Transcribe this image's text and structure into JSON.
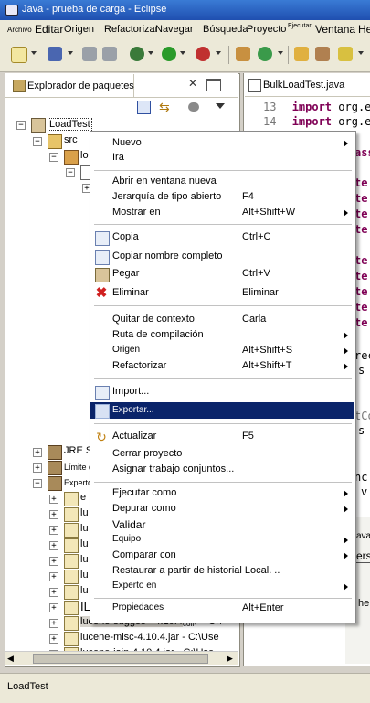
{
  "window": {
    "title": "Java - prueba de carga - Eclipse"
  },
  "menubar": [
    "Archivo",
    "Editar",
    "Origen",
    "Refactorizar",
    "Navegar",
    "Búsqueda",
    "Proyecto",
    "Ejecutar",
    "Ventana",
    "He"
  ],
  "left_view": {
    "tab_title": "Explorador de paquetes",
    "tree": [
      {
        "label": "LoadTest",
        "expander": "−"
      },
      {
        "label": "src",
        "expander": "−"
      },
      {
        "label": "lo",
        "expander": "−"
      },
      {
        "label": "",
        "expander": "−"
      },
      {
        "label": "",
        "expander": "+"
      },
      {
        "label": "JRE S",
        "expander": "+"
      },
      {
        "label": "Límite de",
        "expander": "+"
      },
      {
        "label": "Experto en",
        "expander": "−"
      },
      {
        "label": "e",
        "expander": "+"
      },
      {
        "label": "lu",
        "expander": "+"
      },
      {
        "label": "lu",
        "expander": "+"
      },
      {
        "label": "lu",
        "expander": "+"
      },
      {
        "label": "lu",
        "expander": "+"
      },
      {
        "label": "lu",
        "expander": "+"
      },
      {
        "label": "lu",
        "expander": "+"
      },
      {
        "label": "IL",
        "expander": "+"
      },
      {
        "label": "lucene-sugges - 4.10.4",
        "expander": "+",
        "suffix": "C:\\",
        "note": "coif-"
      },
      {
        "label": "lucene-misc-4.10.4.jar - C:\\Use",
        "expander": "+"
      },
      {
        "label": "lucene-join-4.10.4.jar - C:\\Use",
        "expander": "+"
      }
    ]
  },
  "editor": {
    "tab_title": "BulkLoadTest.java",
    "lines": [
      {
        "num": "13",
        "kw": "import",
        "text": " org.e"
      },
      {
        "num": "14",
        "kw": "import",
        "text": " org.e"
      }
    ],
    "fragments": [
      "ass",
      "te",
      "te",
      "te",
      "te",
      "te",
      "te",
      "te",
      "te",
      "te",
      "rec",
      "s",
      "tCo",
      "s",
      "nc",
      "v",
      "ava",
      "ers",
      "he"
    ]
  },
  "statusbar": {
    "text": "LoadTest"
  },
  "context_menu": {
    "items": [
      {
        "label": "Nuevo",
        "accel": "",
        "submenu": true
      },
      {
        "label": "Ira",
        "accel": "",
        "submenu": false
      },
      {
        "sep": true
      },
      {
        "label": "Abrir en ventana nueva",
        "accel": "",
        "submenu": false
      },
      {
        "label": "Jerarquía de tipo abierto",
        "accel": "F4",
        "submenu": false
      },
      {
        "label": "Mostrar en",
        "accel": "Alt+Shift+W",
        "submenu": true
      },
      {
        "sep": true
      },
      {
        "label": "Copia",
        "accel": "Ctrl+C",
        "submenu": false,
        "icon": "copy-icon"
      },
      {
        "label": "Copiar nombre completo",
        "accel": "",
        "submenu": false,
        "icon": "copy-qualified-name-icon"
      },
      {
        "label": "Pegar",
        "accel": "Ctrl+V",
        "submenu": false,
        "icon": "paste-icon"
      },
      {
        "label": "Eliminar",
        "accel": "Eliminar",
        "submenu": false,
        "icon": "delete-icon"
      },
      {
        "sep": true
      },
      {
        "label": "Quitar de contexto",
        "accel": "Carla",
        "submenu": false
      },
      {
        "label": "Ruta de compilación",
        "accel": "",
        "submenu": true
      },
      {
        "label": "Origen",
        "accel": "Alt+Shift+S",
        "submenu": true
      },
      {
        "label": "Refactorizar",
        "accel": "Alt+Shift+T",
        "submenu": true
      },
      {
        "sep": true
      },
      {
        "label": "Import...",
        "accel": "",
        "submenu": false,
        "icon": "import-icon"
      },
      {
        "label": "Exportar...",
        "accel": "",
        "submenu": false,
        "icon": "export-icon",
        "highlighted": true
      },
      {
        "sep": true
      },
      {
        "label": "Actualizar",
        "accel": "F5",
        "submenu": false,
        "icon": "refresh-icon"
      },
      {
        "label": "Cerrar proyecto",
        "accel": "",
        "submenu": false
      },
      {
        "label": "Asignar trabajo conjuntos...",
        "accel": "",
        "submenu": false
      },
      {
        "sep": true
      },
      {
        "label": "Ejecutar como",
        "accel": "",
        "submenu": true
      },
      {
        "label": "Depurar como",
        "accel": "",
        "submenu": true
      },
      {
        "label": "Validar",
        "accel": "",
        "submenu": false
      },
      {
        "label": "Equipo",
        "accel": "",
        "submenu": true
      },
      {
        "label": "Comparar con",
        "accel": "",
        "submenu": true
      },
      {
        "label": "Restaurar a partir de historial Local. ..",
        "accel": "",
        "submenu": false
      },
      {
        "label": "Experto en",
        "accel": "",
        "submenu": true
      },
      {
        "sep": true
      },
      {
        "label": "Propiedades",
        "accel": "Alt+Enter",
        "submenu": false
      }
    ]
  }
}
